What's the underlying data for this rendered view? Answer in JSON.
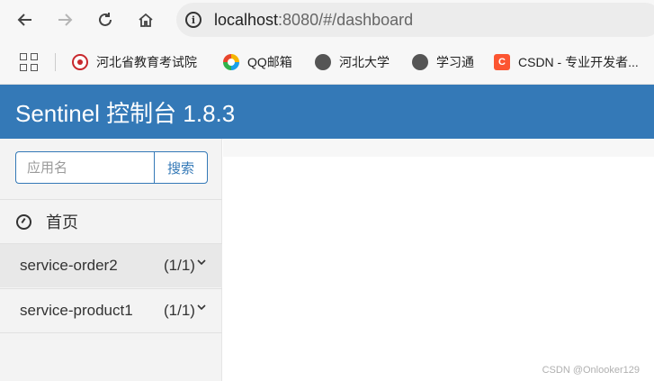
{
  "browser": {
    "url_host": "localhost",
    "url_rest": ":8080/#/dashboard",
    "bookmarks": [
      {
        "label": "河北省教育考试院",
        "icon": "seal-icon"
      },
      {
        "label": "QQ邮箱",
        "icon": "qq-mail-icon"
      },
      {
        "label": "河北大学",
        "icon": "globe-icon"
      },
      {
        "label": "学习通",
        "icon": "globe-icon"
      },
      {
        "label": "CSDN - 专业开发者...",
        "icon": "csdn-icon",
        "letter": "C"
      }
    ]
  },
  "app": {
    "title": "Sentinel 控制台 1.8.3",
    "colors": {
      "header": "#3479b7"
    }
  },
  "sidebar": {
    "search": {
      "placeholder": "应用名",
      "button_label": "搜索"
    },
    "home_label": "首页",
    "services": [
      {
        "name": "service-order2",
        "count": "(1/1)"
      },
      {
        "name": "service-product1",
        "count": "(1/1)"
      }
    ]
  },
  "watermark": "CSDN @Onlooker129"
}
